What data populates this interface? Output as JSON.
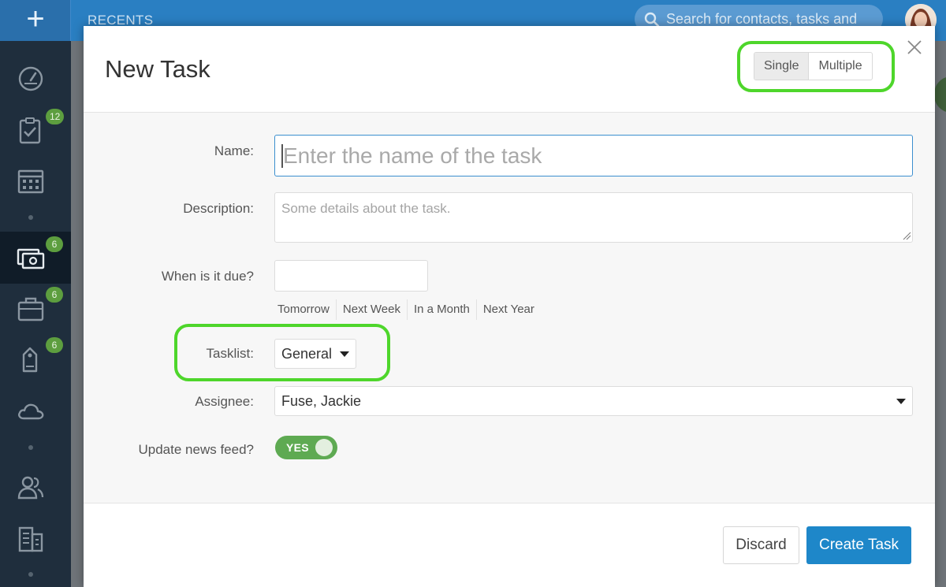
{
  "app": {
    "recents_label": "RECENTS",
    "search_placeholder": "Search for contacts, tasks and",
    "sidebar": {
      "items": [
        {
          "icon": "dashboard-icon",
          "badge": ""
        },
        {
          "icon": "clipboard-check-icon",
          "badge": "12"
        },
        {
          "icon": "calendar-icon",
          "badge": ""
        },
        {
          "icon": "deals-icon",
          "badge": "6",
          "active": true
        },
        {
          "icon": "briefcase-icon",
          "badge": "6"
        },
        {
          "icon": "tag-icon",
          "badge": "6"
        },
        {
          "icon": "cloud-icon",
          "badge": ""
        },
        {
          "icon": "contacts-icon",
          "badge": ""
        },
        {
          "icon": "building-icon",
          "badge": ""
        }
      ]
    }
  },
  "modal": {
    "title": "New Task",
    "mode_options": [
      "Single",
      "Multiple"
    ],
    "mode_selected": "Single",
    "fields": {
      "name_label": "Name:",
      "name_placeholder": "Enter the name of the task",
      "description_label": "Description:",
      "description_placeholder": "Some details about the task.",
      "due_label": "When is it due?",
      "quick_dates": [
        "Tomorrow",
        "Next Week",
        "In a Month",
        "Next Year"
      ],
      "tasklist_label": "Tasklist:",
      "tasklist_value": "General",
      "assignee_label": "Assignee:",
      "assignee_value": "Fuse, Jackie",
      "newsfeed_label": "Update news feed?",
      "newsfeed_toggle": "YES"
    },
    "footer": {
      "discard_label": "Discard",
      "create_label": "Create Task"
    }
  },
  "colors": {
    "accent_blue": "#1e87c9",
    "topbar_blue": "#2a7fc2",
    "sidebar_dark": "#1f2e3d",
    "badge_green": "#5d9e3f",
    "toggle_green": "#5eaa52",
    "highlight_green": "#4ed62b"
  }
}
